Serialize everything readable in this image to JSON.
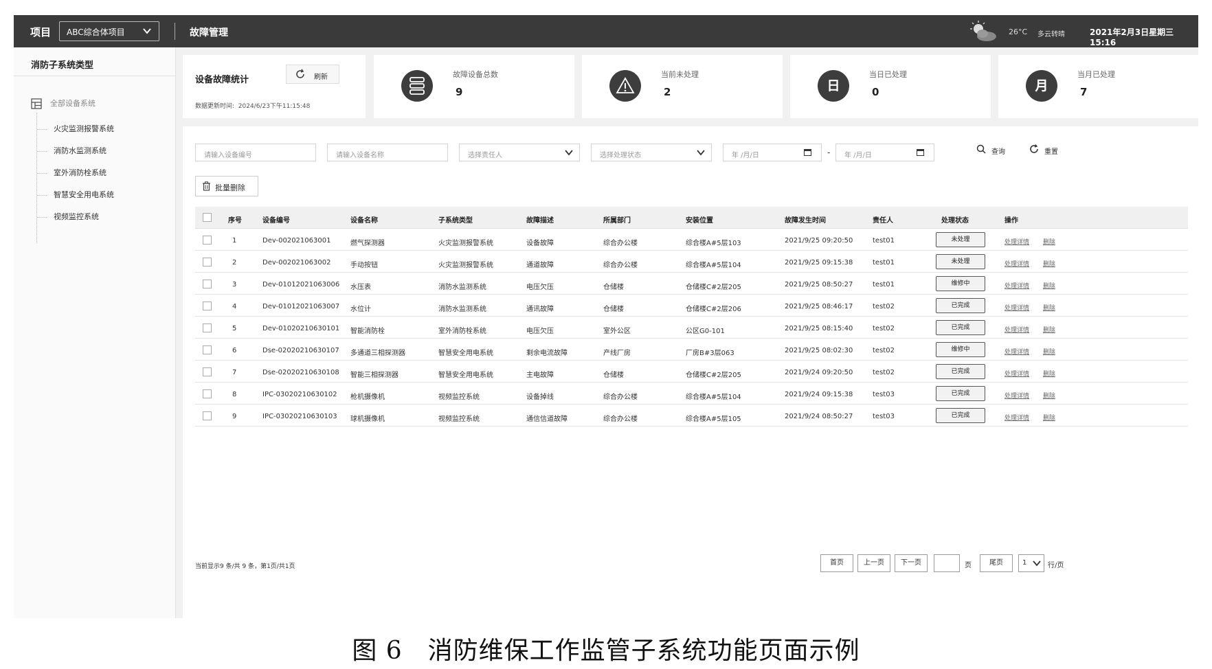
{
  "header": {
    "project_label": "项目",
    "project_value": "ABC综合体项目",
    "module_title": "故障管理",
    "temperature": "26°C",
    "weather": "多云转晴",
    "datetime": "2021年2月3日星期三 15:16"
  },
  "sidebar": {
    "title": "消防子系统类型",
    "root": "全部设备系统",
    "items": [
      {
        "label": "火灾监测报警系统"
      },
      {
        "label": "消防水监测系统"
      },
      {
        "label": "室外消防栓系统"
      },
      {
        "label": "智慧安全用电系统"
      },
      {
        "label": "视频监控系统"
      }
    ]
  },
  "stats": {
    "title": "设备故障统计",
    "refresh_label": "刷新",
    "updated_label": "数据更新时间:",
    "updated_time": "2024/6/23下午11:15:48",
    "cards": [
      {
        "label": "故障设备总数",
        "value": "9",
        "icon": "server-icon",
        "glyph": ""
      },
      {
        "label": "当前未处理",
        "value": "2",
        "icon": "warning-icon",
        "glyph": ""
      },
      {
        "label": "当日已处理",
        "value": "0",
        "icon": "day-icon",
        "glyph": "日"
      },
      {
        "label": "当月已处理",
        "value": "7",
        "icon": "month-icon",
        "glyph": "月"
      }
    ]
  },
  "filters": {
    "device_no_placeholder": "请输入设备编号",
    "device_name_placeholder": "请输入设备名称",
    "owner_placeholder": "选择责任人",
    "status_placeholder": "选择处理状态",
    "date_start_placeholder": "年 /月/日",
    "date_sep": "-",
    "date_end_placeholder": "年 /月/日",
    "search_label": "查询",
    "reset_label": "重置"
  },
  "batch_delete_label": "批量删除",
  "table": {
    "columns": [
      "序号",
      "设备编号",
      "设备名称",
      "子系统类型",
      "故障描述",
      "所属部门",
      "安装位置",
      "故障发生时间",
      "责任人",
      "处理状态",
      "操作"
    ],
    "rows": [
      {
        "no": "1",
        "device_no": "Dev-002021063001",
        "name": "燃气探测器",
        "subsystem": "火灾监测报警系统",
        "fault": "设备故障",
        "dept": "综合办公楼",
        "location": "综合楼A#5层103",
        "time": "2021/9/25 09:20:50",
        "owner": "test01",
        "status": "未处理",
        "op_detail": "处理详情",
        "op_delete": "删除"
      },
      {
        "no": "2",
        "device_no": "Dev-002021063002",
        "name": "手动按钮",
        "subsystem": "火灾监测报警系统",
        "fault": "通道故障",
        "dept": "综合办公楼",
        "location": "综合楼A#5层104",
        "time": "2021/9/25 09:15:38",
        "owner": "test01",
        "status": "未处理",
        "op_detail": "处理详情",
        "op_delete": "删除"
      },
      {
        "no": "3",
        "device_no": "Dev-01012021063006",
        "name": "水压表",
        "subsystem": "消防水监测系统",
        "fault": "电压欠压",
        "dept": "仓储楼",
        "location": "仓储楼C#2层205",
        "time": "2021/9/25 08:50:27",
        "owner": "test01",
        "status": "维修中",
        "op_detail": "处理详情",
        "op_delete": "删除"
      },
      {
        "no": "4",
        "device_no": "Dev-01012021063007",
        "name": "水位计",
        "subsystem": "消防水监测系统",
        "fault": "通讯故障",
        "dept": "仓储楼",
        "location": "仓储楼C#2层206",
        "time": "2021/9/25 08:46:17",
        "owner": "test02",
        "status": "已完成",
        "op_detail": "处理详情",
        "op_delete": "删除"
      },
      {
        "no": "5",
        "device_no": "Dev-01020210630101",
        "name": "智能消防栓",
        "subsystem": "室外消防栓系统",
        "fault": "电压欠压",
        "dept": "室外公区",
        "location": "公区G0-101",
        "time": "2021/9/25 08:15:40",
        "owner": "test02",
        "status": "已完成",
        "op_detail": "处理详情",
        "op_delete": "删除"
      },
      {
        "no": "6",
        "device_no": "Dse-02020210630107",
        "name": "多通道三相探测器",
        "subsystem": "智慧安全用电系统",
        "fault": "剩余电流故障",
        "dept": "产线厂房",
        "location": "厂房B#3层063",
        "time": "2021/9/25 08:02:30",
        "owner": "test02",
        "status": "维修中",
        "op_detail": "处理详情",
        "op_delete": "删除"
      },
      {
        "no": "7",
        "device_no": "Dse-02020210630108",
        "name": "智能三相探测器",
        "subsystem": "智慧安全用电系统",
        "fault": "主电故障",
        "dept": "仓储楼",
        "location": "仓储楼C#2层205",
        "time": "2021/9/24 09:20:50",
        "owner": "test02",
        "status": "已完成",
        "op_detail": "处理详情",
        "op_delete": "删除"
      },
      {
        "no": "8",
        "device_no": "IPC-03020210630102",
        "name": "枪机摄像机",
        "subsystem": "视频监控系统",
        "fault": "设备掉线",
        "dept": "综合办公楼",
        "location": "综合楼A#5层104",
        "time": "2021/9/24 09:15:38",
        "owner": "test03",
        "status": "已完成",
        "op_detail": "处理详情",
        "op_delete": "删除"
      },
      {
        "no": "9",
        "device_no": "IPC-03020210630103",
        "name": "球机摄像机",
        "subsystem": "视频监控系统",
        "fault": "通信信道故障",
        "dept": "综合办公楼",
        "location": "综合楼A#5层105",
        "time": "2021/9/24 08:50:27",
        "owner": "test03",
        "status": "已完成",
        "op_detail": "处理详情",
        "op_delete": "删除"
      }
    ]
  },
  "pagination": {
    "info": "当前显示9 条/共 9 条，第1页/共1页",
    "first": "首页",
    "prev": "上一页",
    "next": "下一页",
    "page_unit": "页",
    "last": "尾页",
    "page_size": "1",
    "per_page_unit": "行/页"
  },
  "caption": "图 6　消防维保工作监管子系统功能页面示例"
}
